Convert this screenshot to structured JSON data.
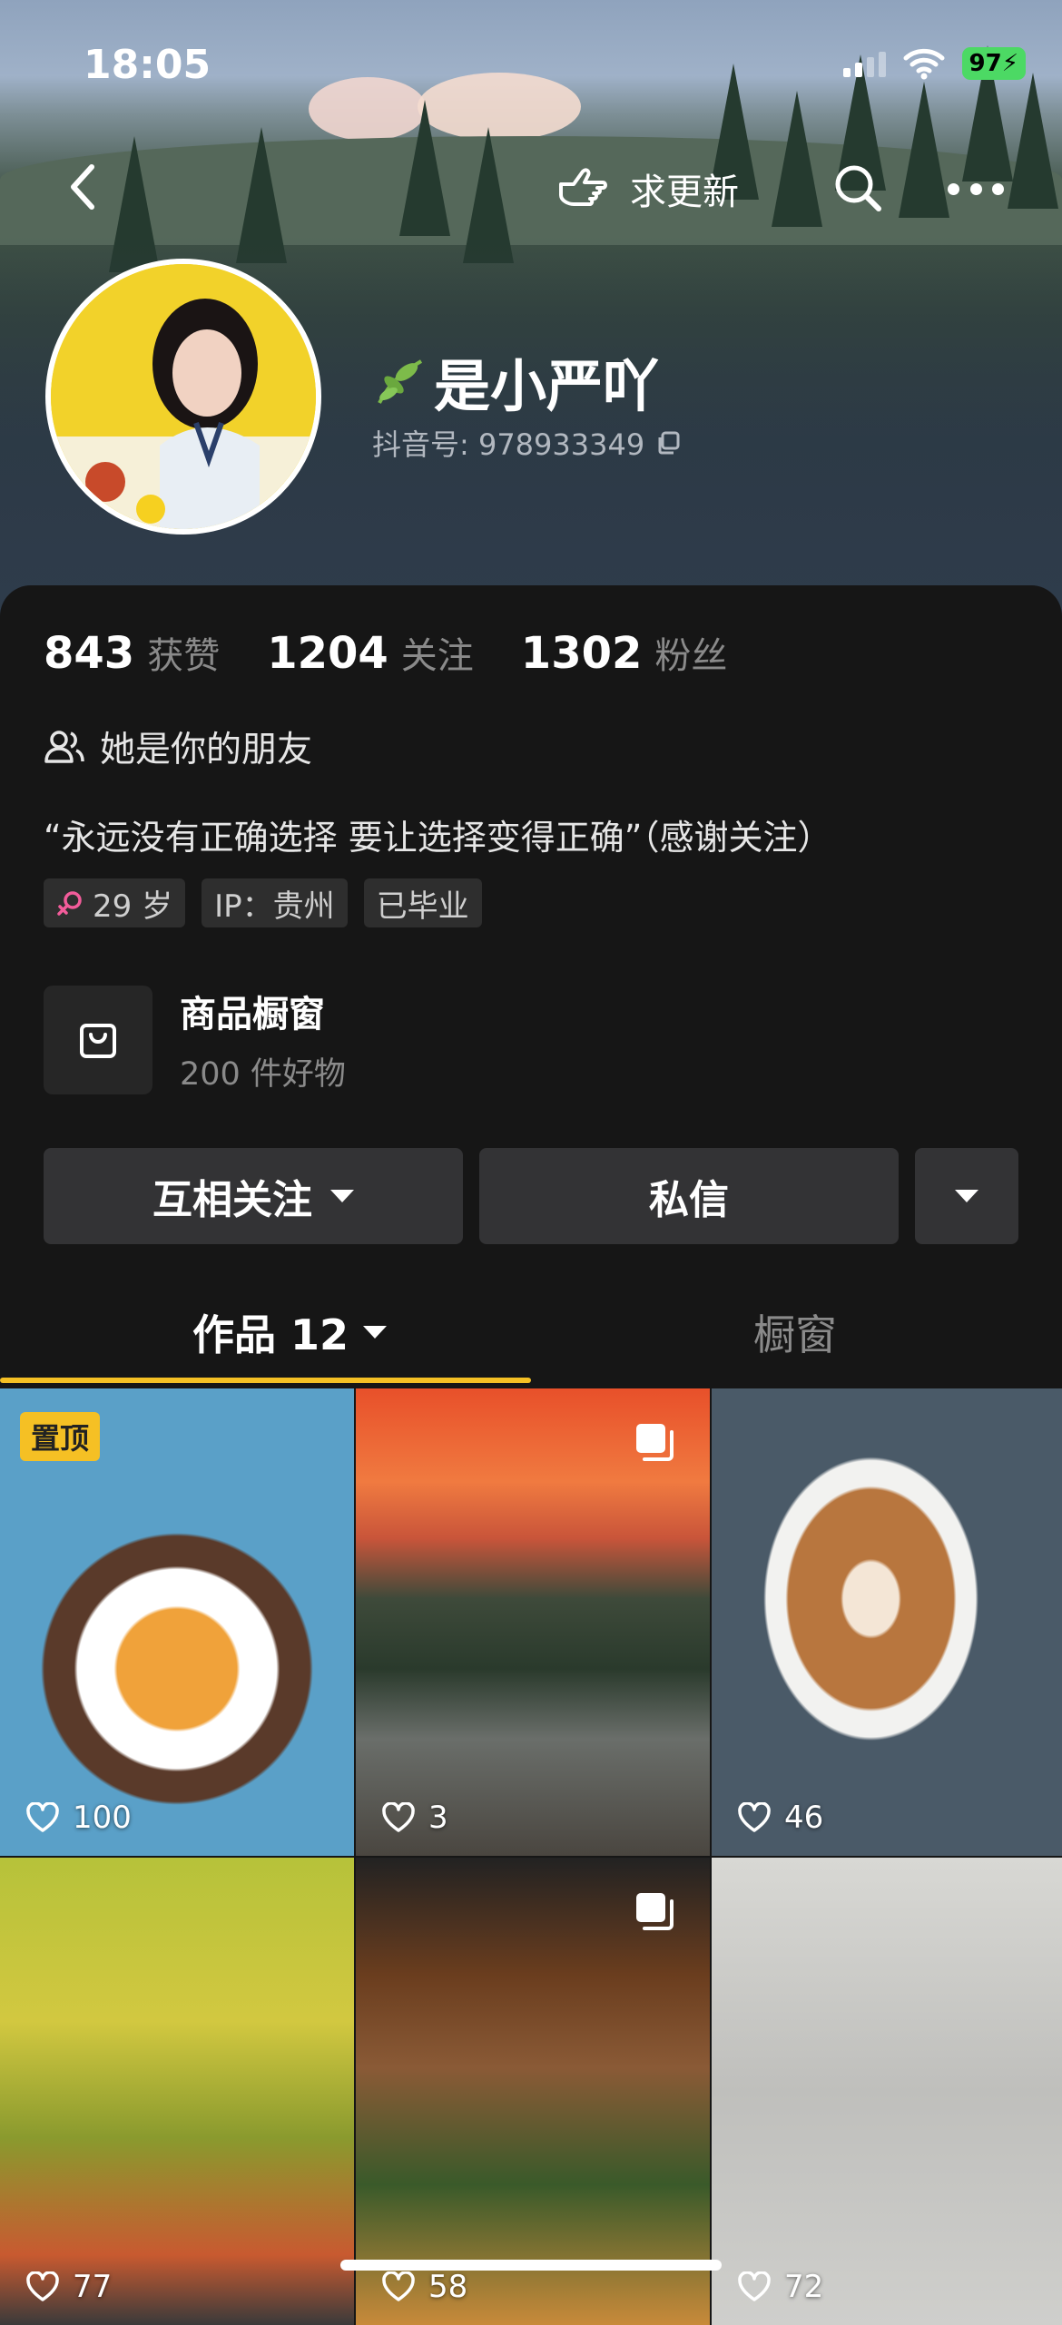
{
  "status_bar": {
    "time": "18:05",
    "battery": "97"
  },
  "nav": {
    "update_label": "求更新"
  },
  "profile": {
    "username": "是小严吖",
    "douyin_id": "抖音号: 978933349"
  },
  "stats": [
    {
      "value": "843",
      "label": "获赞"
    },
    {
      "value": "1204",
      "label": "关注"
    },
    {
      "value": "1302",
      "label": "粉丝"
    }
  ],
  "friend_text": "她是你的朋友",
  "bio": "“永远没有正确选择 要让选择变得正确”（感谢关注）",
  "tags": {
    "age": "29 岁",
    "ip": "IP：贵州",
    "education": "已毕业"
  },
  "shop": {
    "title": "商品橱窗",
    "subtitle": "200 件好物"
  },
  "actions": {
    "follow": "互相关注",
    "message": "私信"
  },
  "tabs": {
    "works": "作品 12",
    "showcase": "橱窗"
  },
  "videos": [
    {
      "likes": "100",
      "pinned": "置顶"
    },
    {
      "likes": "3"
    },
    {
      "likes": "46"
    },
    {
      "likes": "77"
    },
    {
      "likes": "58"
    },
    {
      "likes": "72"
    }
  ],
  "colors": {
    "accent": "#f5c024",
    "background": "#161616",
    "button": "#333335"
  }
}
